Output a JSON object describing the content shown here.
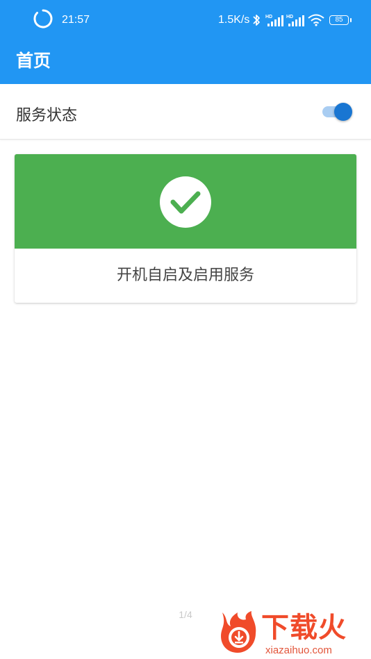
{
  "status_bar": {
    "time": "21:57",
    "net_speed": "1.5K/s",
    "battery": "85",
    "signal_label": "HD",
    "icons": [
      "loading-ring-icon",
      "bluetooth-icon",
      "hd-signal-icon",
      "hd-signal-icon",
      "wifi-icon",
      "battery-icon"
    ]
  },
  "app_bar": {
    "title": "首页"
  },
  "service_status": {
    "label": "服务状态",
    "toggle_on": true
  },
  "card": {
    "icon": "check-circle-icon",
    "label": "开机自启及启用服务"
  },
  "pager": {
    "text": "1/4"
  },
  "watermark": {
    "brand": "下载火",
    "domain": "xiazaihuo.com"
  },
  "colors": {
    "primary": "#2196f3",
    "toggle_thumb": "#1976d2",
    "toggle_track": "#a9cdf2",
    "success": "#4caf50",
    "watermark": "#f04b2a"
  }
}
